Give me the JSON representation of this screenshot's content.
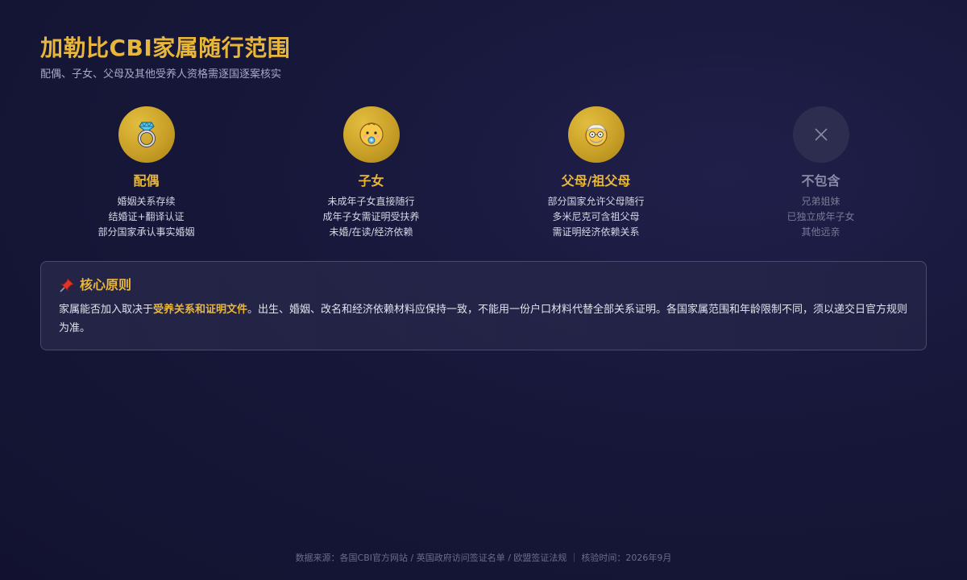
{
  "header": {
    "title": "加勒比CBI家属随行范围",
    "subtitle": "配偶、子女、父母及其他受养人资格需逐国逐案核实"
  },
  "categories": [
    {
      "icon": "ring-icon",
      "title": "配偶",
      "lines": [
        "婚姻关系存续",
        "结婚证+翻译认证",
        "部分国家承认事实婚姻"
      ]
    },
    {
      "icon": "baby-icon",
      "title": "子女",
      "lines": [
        "未成年子女直接随行",
        "成年子女需证明受扶养",
        "未婚/在读/经济依赖"
      ]
    },
    {
      "icon": "old-man-icon",
      "title": "父母/祖父母",
      "lines": [
        "部分国家允许父母随行",
        "多米尼克可含祖父母",
        "需证明经济依赖关系"
      ]
    },
    {
      "icon": "close-icon",
      "title": "不包含",
      "lines": [
        "兄弟姐妹",
        "已独立成年子女",
        "其他远亲"
      ]
    }
  ],
  "principle": {
    "icon": "pushpin-icon",
    "title": "核心原则",
    "text_before": "家属能否加入取决于",
    "text_highlight": "受养关系和证明文件",
    "text_after": "。出生、婚姻、改名和经济依赖材料应保持一致，不能用一份户口材料代替全部关系证明。各国家属范围和年龄限制不同，须以递交日官方规则为准。"
  },
  "footer": {
    "text": "数据来源：各国CBI官方网站 / 英国政府访问签证名单 / 欧盟签证法规 ｜ 核验时间：2026年9月"
  },
  "colors": {
    "accent": "#e8b73a",
    "background": "#17173a",
    "muted_circle": "#2d2d50"
  }
}
